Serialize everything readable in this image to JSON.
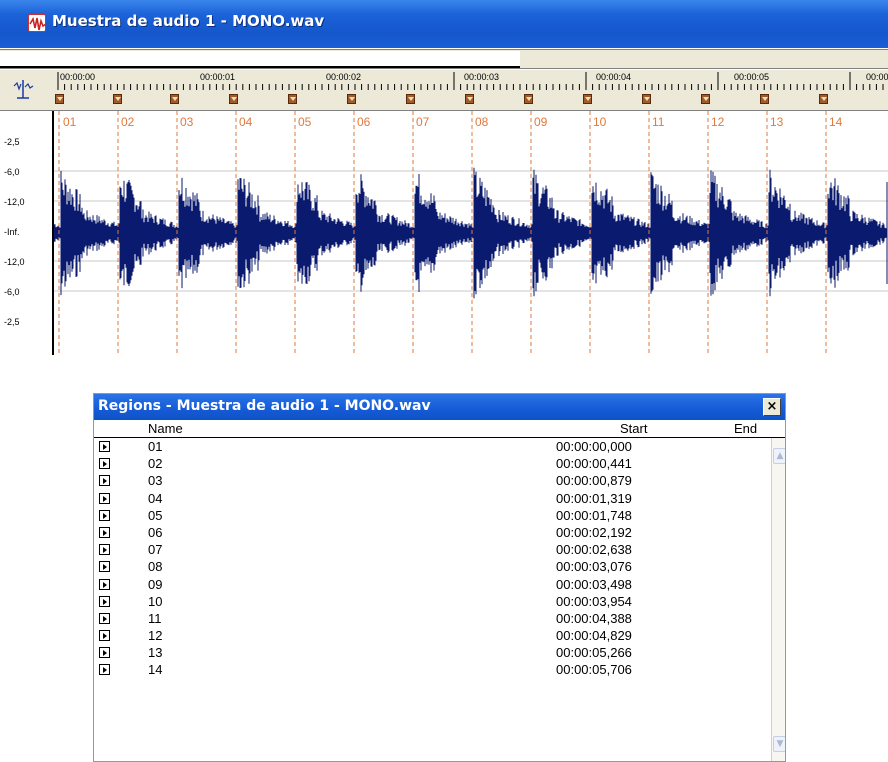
{
  "audio_window": {
    "title": "Muestra de audio 1 - MONO.wav",
    "time_ticks": [
      "00:00:00",
      "00:00:01",
      "00:00:02",
      "00:00:03",
      "00:00:04",
      "00:00:05",
      "00:00"
    ],
    "db_labels": [
      "-2,5",
      "-6,0",
      "-12,0",
      "-Inf.",
      "-12,0",
      "-6,0",
      "-2,5"
    ],
    "region_labels": [
      "01",
      "02",
      "03",
      "04",
      "05",
      "06",
      "07",
      "08",
      "09",
      "10",
      "11",
      "12",
      "13",
      "14"
    ],
    "colors": {
      "titlebar": "#1c62d8",
      "waveform": "#0a1a6e",
      "region_marker": "#e07a3c"
    },
    "icons": {
      "app": "audio-wave-icon",
      "ruler_toggle": "ruler-marker-icon"
    }
  },
  "regions_window": {
    "title": "Regions - Muestra de audio 1 - MONO.wav",
    "close_label": "×",
    "columns": {
      "name": "Name",
      "start": "Start",
      "end": "End"
    },
    "rows": [
      {
        "name": "01",
        "start": "00:00:00,000"
      },
      {
        "name": "02",
        "start": "00:00:00,441"
      },
      {
        "name": "03",
        "start": "00:00:00,879"
      },
      {
        "name": "04",
        "start": "00:00:01,319"
      },
      {
        "name": "05",
        "start": "00:00:01,748"
      },
      {
        "name": "06",
        "start": "00:00:02,192"
      },
      {
        "name": "07",
        "start": "00:00:02,638"
      },
      {
        "name": "08",
        "start": "00:00:03,076"
      },
      {
        "name": "09",
        "start": "00:00:03,498"
      },
      {
        "name": "10",
        "start": "00:00:03,954"
      },
      {
        "name": "11",
        "start": "00:00:04,388"
      },
      {
        "name": "12",
        "start": "00:00:04,829"
      },
      {
        "name": "13",
        "start": "00:00:05,266"
      },
      {
        "name": "14",
        "start": "00:00:05,706"
      }
    ],
    "scroll_up": "▲",
    "scroll_down": "▼"
  }
}
